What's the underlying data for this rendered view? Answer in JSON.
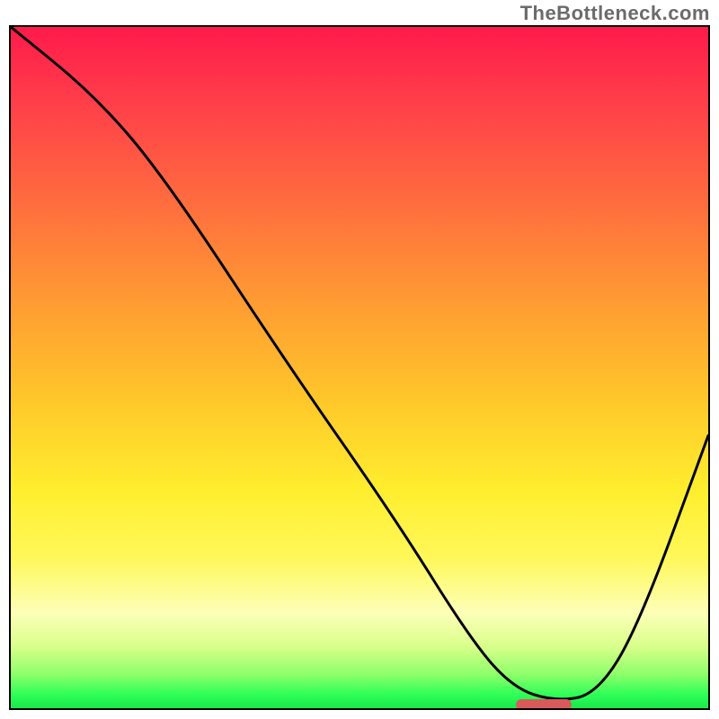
{
  "watermark": "TheBottleneck.com",
  "colors": {
    "top": "#ff1a4b",
    "mid": "#ffee2e",
    "bottom": "#18e84a",
    "marker": "#d85a5a",
    "curve": "#000000"
  },
  "chart_data": {
    "type": "line",
    "title": "",
    "xlabel": "",
    "ylabel": "",
    "xlim": [
      0,
      100
    ],
    "ylim": [
      0,
      100
    ],
    "grid": false,
    "legend": false,
    "series": [
      {
        "name": "bottleneck-curve",
        "x": [
          0,
          12,
          22,
          40,
          55,
          66,
          72,
          78,
          84,
          90,
          100
        ],
        "y": [
          100,
          90,
          78,
          50,
          28,
          10,
          3,
          1,
          2,
          12,
          40
        ]
      }
    ],
    "marker": {
      "x_start": 72,
      "x_end": 80,
      "y": 1,
      "color": "#d85a5a"
    },
    "annotations": []
  }
}
